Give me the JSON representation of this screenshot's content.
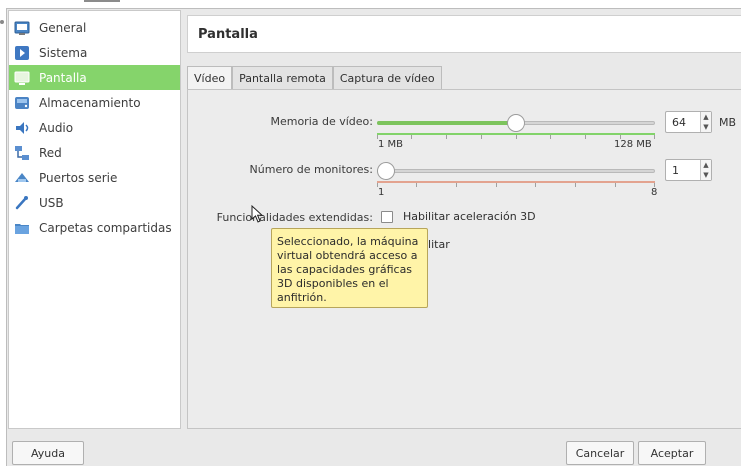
{
  "sidebar": {
    "items": [
      {
        "label": "General",
        "icon": "general-icon"
      },
      {
        "label": "Sistema",
        "icon": "system-icon"
      },
      {
        "label": "Pantalla",
        "icon": "display-icon"
      },
      {
        "label": "Almacenamiento",
        "icon": "storage-icon"
      },
      {
        "label": "Audio",
        "icon": "audio-icon"
      },
      {
        "label": "Red",
        "icon": "network-icon"
      },
      {
        "label": "Puertos serie",
        "icon": "serial-ports-icon"
      },
      {
        "label": "USB",
        "icon": "usb-icon"
      },
      {
        "label": "Carpetas compartidas",
        "icon": "shared-folders-icon"
      }
    ],
    "selected": "Pantalla"
  },
  "header": {
    "title": "Pantalla"
  },
  "tabs": [
    {
      "label": "Vídeo",
      "active": true
    },
    {
      "label": "Pantalla remota",
      "active": false
    },
    {
      "label": "Captura de vídeo",
      "active": false
    }
  ],
  "video": {
    "memory": {
      "label": "Memoria de vídeo:",
      "value": "64",
      "unit": "MB",
      "min_label": "1 MB",
      "max_label": "128 MB",
      "level": 0.5
    },
    "monitors": {
      "label": "Número de monitores:",
      "value": "1",
      "min_label": "1",
      "max_label": "8",
      "level": 0.0
    },
    "extended": {
      "label": "Funcionalidades extendidas:",
      "accel3d": "Habilitar aceleración 3D",
      "accel2d": "Habilitar"
    }
  },
  "tooltip": {
    "text": "Seleccionado, la máquina virtual obtendrá acceso a las capacidades gráficas 3D disponibles en el anfitrión."
  },
  "buttons": {
    "help": "Ayuda",
    "cancel": "Cancelar",
    "accept": "Aceptar"
  },
  "colors": {
    "selection": "#85d46b",
    "slider_fill": "#7dc45d",
    "tooltip_bg": "#fff4a8"
  }
}
